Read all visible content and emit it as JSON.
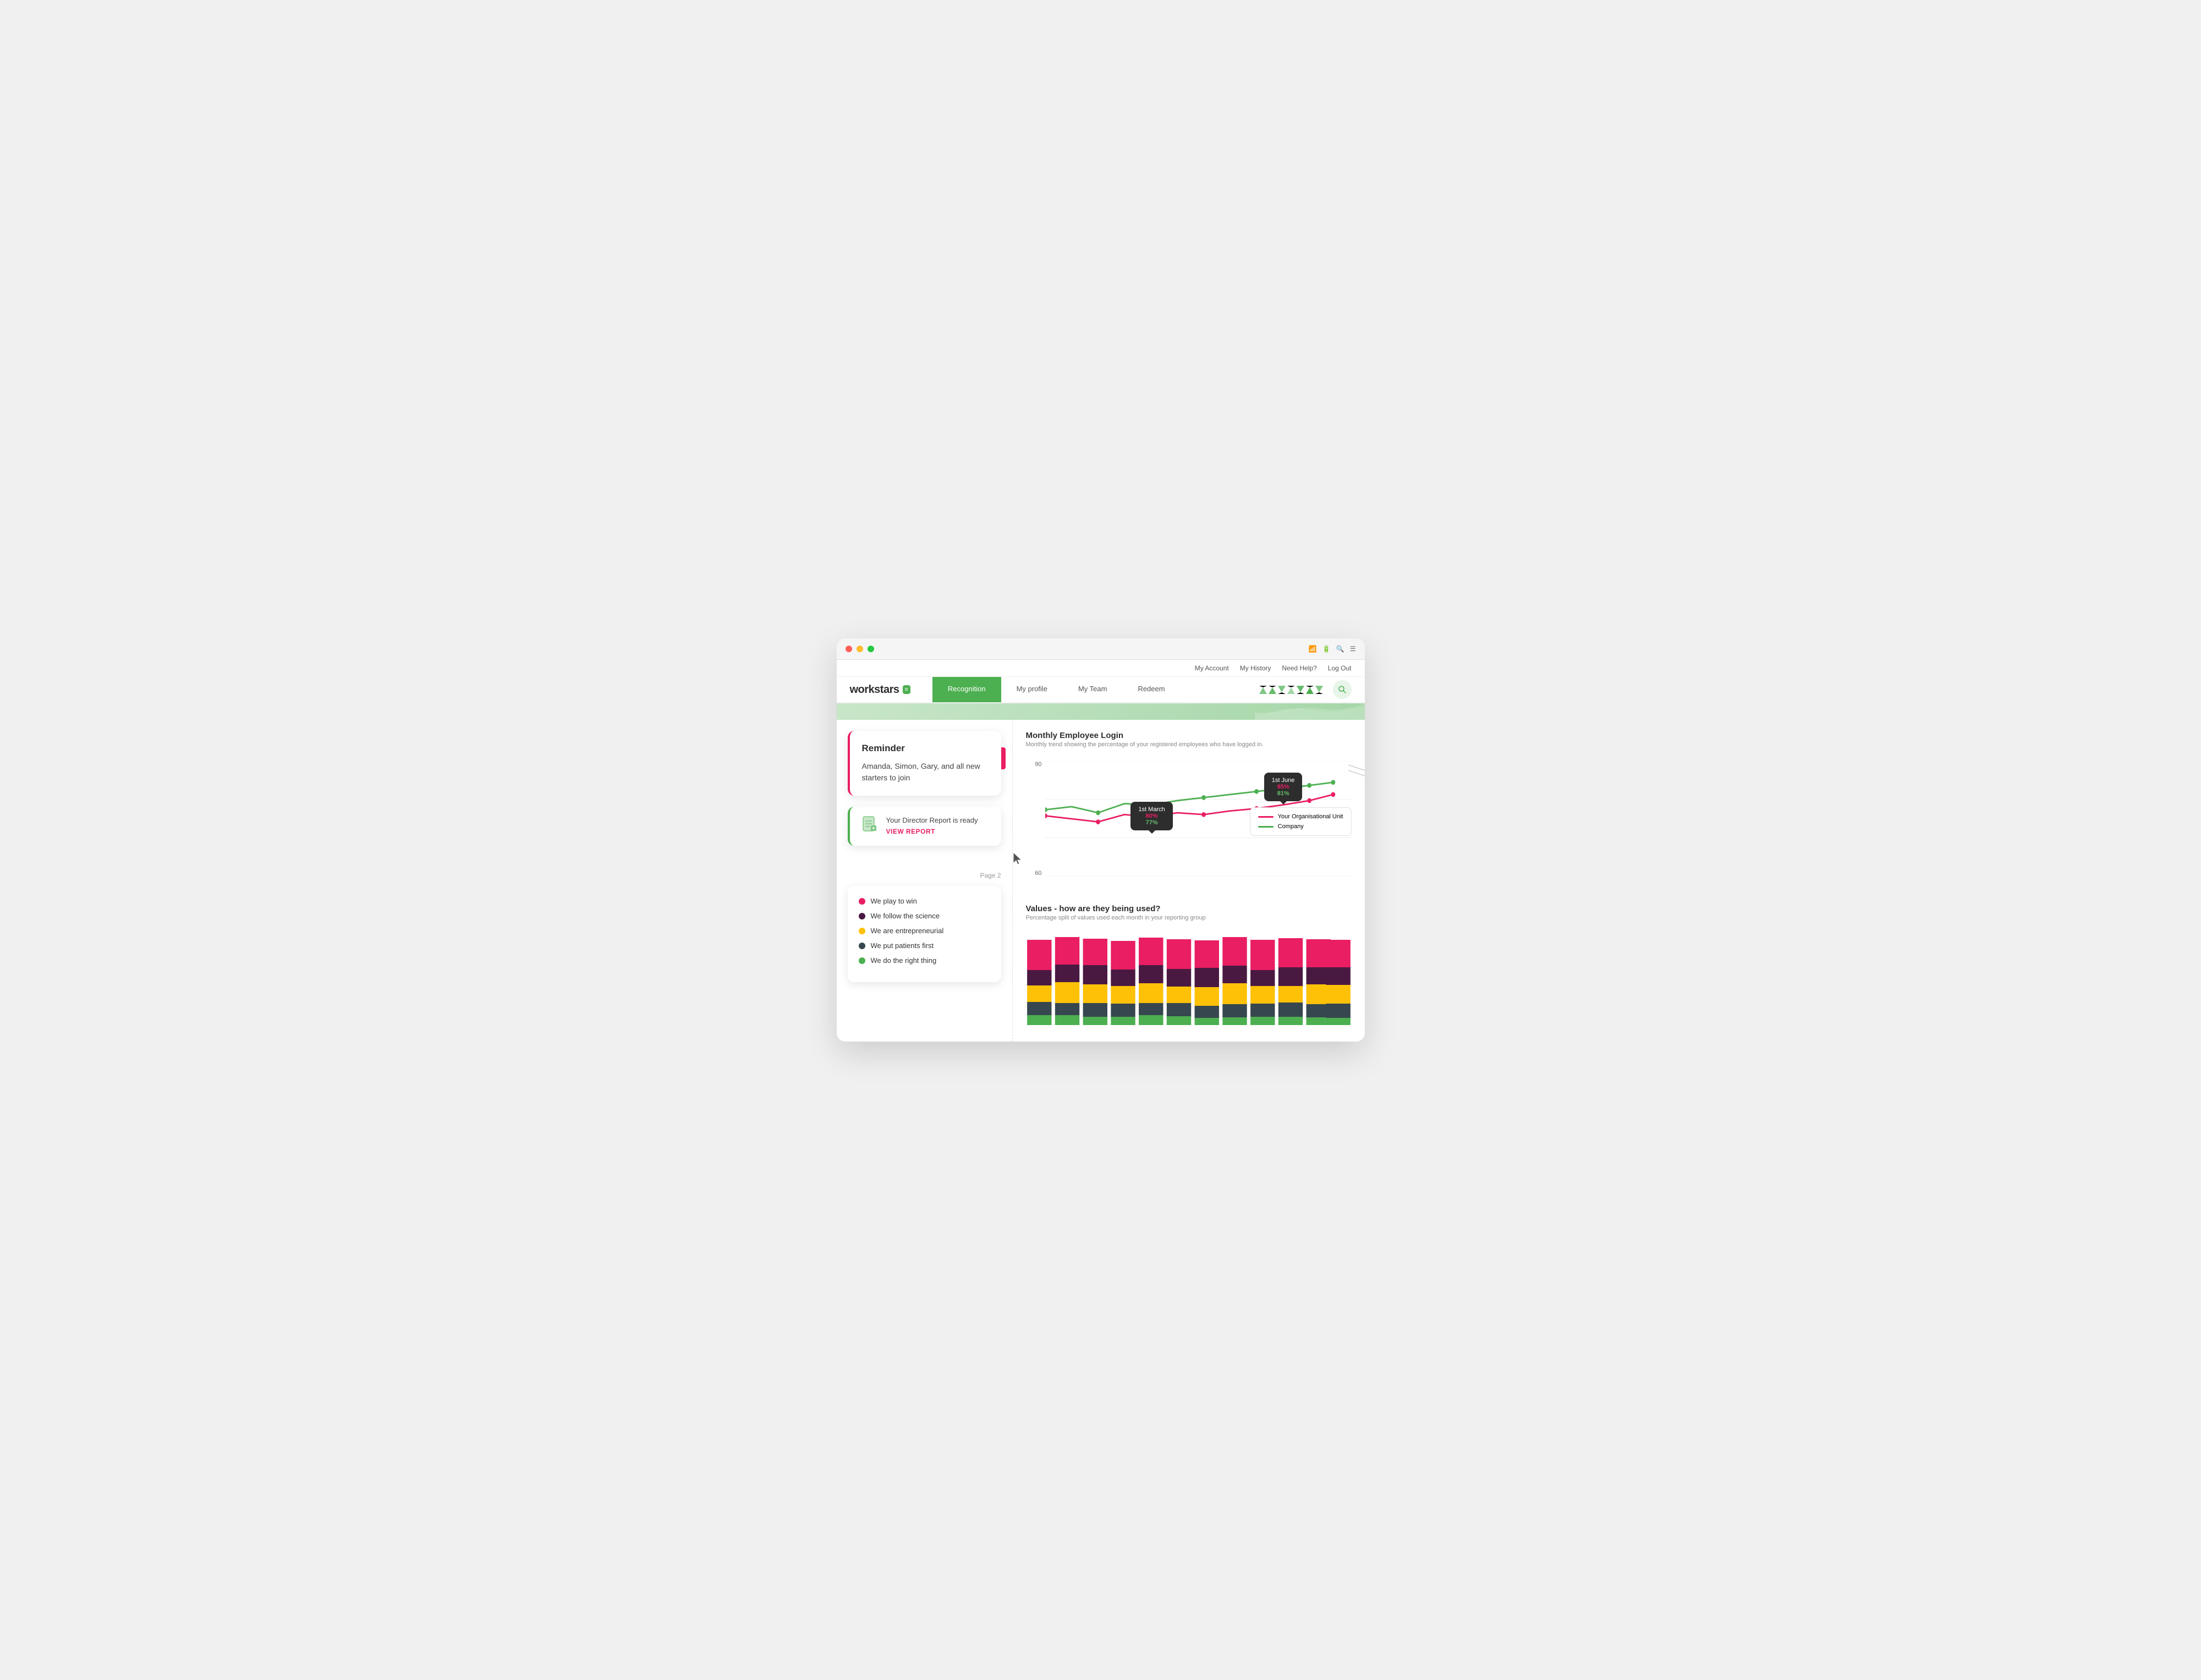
{
  "browser": {
    "dots": [
      "red",
      "yellow",
      "green"
    ],
    "controls": [
      "wifi-icon",
      "battery-icon",
      "search-icon",
      "menu-icon"
    ]
  },
  "topnav": {
    "links": [
      "My Account",
      "My History",
      "Need Help?",
      "Log Out"
    ]
  },
  "logo": {
    "text": "workstars",
    "icon_label": "≡"
  },
  "tabs": [
    {
      "label": "Recognition",
      "active": true
    },
    {
      "label": "My profile",
      "active": false
    },
    {
      "label": "My Team",
      "active": false
    },
    {
      "label": "Redeem",
      "active": false
    }
  ],
  "reminder_card": {
    "title": "Reminder",
    "text": "Amanda, Simon, Gary, and all new starters to join"
  },
  "report_card": {
    "text": "Your Director Report is ready",
    "link": "VIEW REPORT"
  },
  "page_indicator": "Page 2",
  "values_legend": [
    {
      "label": "We play to win",
      "color": "#e91e63"
    },
    {
      "label": "We follow the science",
      "color": "#4a1942"
    },
    {
      "label": "We are entrepreneurial",
      "color": "#ffc107"
    },
    {
      "label": "We put patients first",
      "color": "#37474f"
    },
    {
      "label": "We do the right thing",
      "color": "#4caf50"
    }
  ],
  "line_chart": {
    "title": "Monthly Employee Login",
    "subtitle": "Monthly trend showing the percentage of your registered employees who have logged in.",
    "y_labels": [
      "90",
      "60"
    ],
    "callout1": {
      "date": "1st March",
      "pink_value": "80%",
      "green_value": "77%"
    },
    "callout2": {
      "date": "1st June",
      "pink_value": "85%",
      "green_value": "81%"
    },
    "legend": [
      {
        "label": "Your Organisational Unit",
        "color": "#e91e63"
      },
      {
        "label": "Company",
        "color": "#4caf50"
      }
    ]
  },
  "bar_chart": {
    "title": "Values - how are they being used?",
    "subtitle": "Percentage split of values used each month in your reporting group",
    "segments": [
      {
        "color": "#e91e63",
        "label": "We play to win"
      },
      {
        "color": "#4a1942",
        "label": "We follow the science"
      },
      {
        "color": "#ffc107",
        "label": "We are entrepreneurial"
      },
      {
        "color": "#37474f",
        "label": "We put patients first"
      },
      {
        "color": "#4caf50",
        "label": "We do the right thing"
      }
    ],
    "bars": [
      [
        35,
        18,
        20,
        15,
        12
      ],
      [
        30,
        20,
        25,
        14,
        11
      ],
      [
        28,
        22,
        22,
        16,
        12
      ],
      [
        32,
        19,
        21,
        15,
        13
      ],
      [
        29,
        21,
        23,
        14,
        13
      ],
      [
        33,
        20,
        20,
        15,
        12
      ],
      [
        31,
        22,
        22,
        14,
        11
      ],
      [
        30,
        20,
        24,
        15,
        11
      ],
      [
        34,
        18,
        21,
        15,
        12
      ],
      [
        32,
        21,
        20,
        16,
        11
      ],
      [
        31,
        19,
        23,
        15,
        12
      ],
      [
        30,
        20,
        22,
        16,
        12
      ]
    ]
  }
}
